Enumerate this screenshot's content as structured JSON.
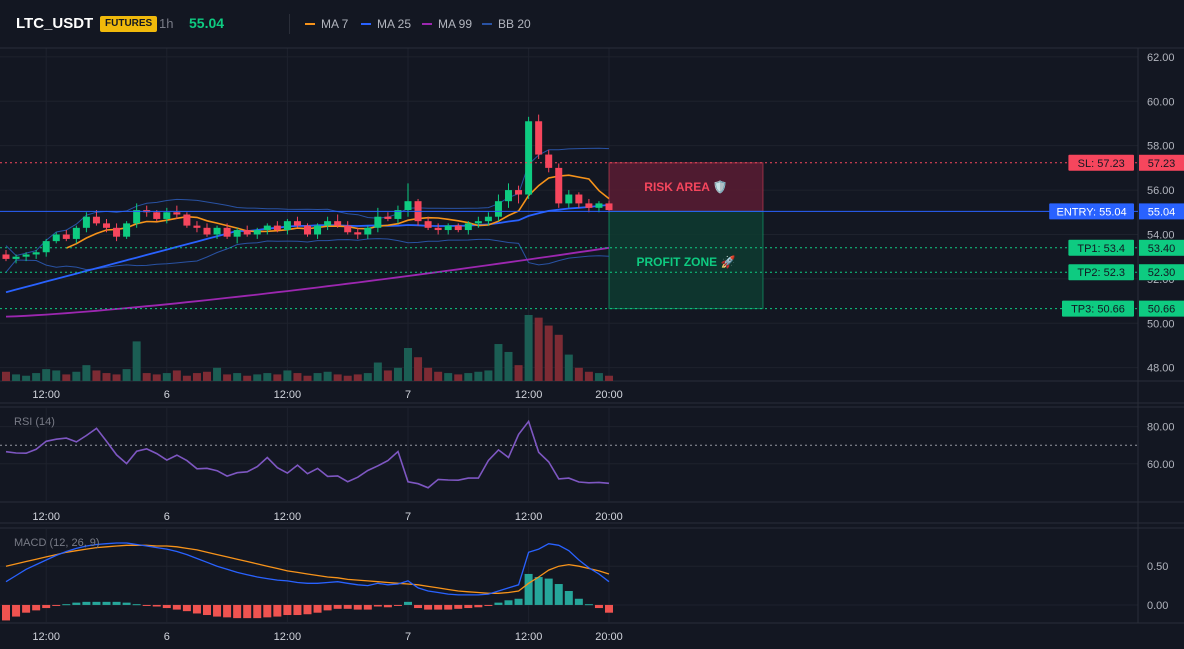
{
  "header": {
    "symbol": "LTC_USDT",
    "badge": "FUTURES",
    "timeframe": "1h",
    "price": "55.04",
    "legend": [
      {
        "label": "MA 7",
        "color": "#f7931a"
      },
      {
        "label": "MA 25",
        "color": "#2962ff"
      },
      {
        "label": "MA 99",
        "color": "#9c27b0"
      },
      {
        "label": "BB 20",
        "color": "#2952a3"
      }
    ]
  },
  "colors": {
    "bg": "#131722",
    "grid": "#1e222d",
    "text": "#b2b5be",
    "up": "#0ecb81",
    "down": "#f6465d",
    "volUp": "#1b5e54",
    "volDown": "#7d2b34",
    "ma7": "#f7931a",
    "ma25": "#2962ff",
    "ma99": "#9c27b0",
    "bb": "#2952a3",
    "rsi": "#7e57c2",
    "macd": "#2962ff",
    "signal": "#f7931a",
    "histUp": "#26a69a",
    "histDown": "#ef5350"
  },
  "chart_data": [
    {
      "type": "candlestick",
      "x_tick_labels": [
        "12:00",
        "6",
        "12:00",
        "7",
        "12:00",
        "20:00"
      ],
      "x_tick_index": [
        4,
        16,
        28,
        40,
        52,
        60
      ],
      "y_tick_labels": [
        "48.00",
        "50.00",
        "52.00",
        "54.00",
        "56.00",
        "58.00",
        "60.00",
        "62.00"
      ],
      "ylim": [
        47.4,
        62.4
      ],
      "candles": [
        [
          53.1,
          53.3,
          52.8,
          52.9
        ],
        [
          52.9,
          53.1,
          52.7,
          53.0
        ],
        [
          53.0,
          53.2,
          52.8,
          53.1
        ],
        [
          53.1,
          53.3,
          52.9,
          53.2
        ],
        [
          53.2,
          53.8,
          53.0,
          53.7
        ],
        [
          53.7,
          54.1,
          53.6,
          54.0
        ],
        [
          54.0,
          54.2,
          53.7,
          53.8
        ],
        [
          53.8,
          54.4,
          53.6,
          54.3
        ],
        [
          54.3,
          55.0,
          54.1,
          54.8
        ],
        [
          54.8,
          55.1,
          54.4,
          54.5
        ],
        [
          54.5,
          54.7,
          54.1,
          54.3
        ],
        [
          54.3,
          54.5,
          53.7,
          53.9
        ],
        [
          53.9,
          54.6,
          53.8,
          54.5
        ],
        [
          54.5,
          55.4,
          54.3,
          55.1
        ],
        [
          55.1,
          55.3,
          54.8,
          55.0
        ],
        [
          55.0,
          55.1,
          54.6,
          54.7
        ],
        [
          54.7,
          55.2,
          54.5,
          55.0
        ],
        [
          55.0,
          55.3,
          54.7,
          54.9
        ],
        [
          54.9,
          55.0,
          54.3,
          54.4
        ],
        [
          54.4,
          54.6,
          54.1,
          54.3
        ],
        [
          54.3,
          54.5,
          53.9,
          54.0
        ],
        [
          54.0,
          54.4,
          53.8,
          54.3
        ],
        [
          54.3,
          54.5,
          53.8,
          53.9
        ],
        [
          53.9,
          54.3,
          53.6,
          54.2
        ],
        [
          54.2,
          54.4,
          53.9,
          54.0
        ],
        [
          54.0,
          54.3,
          53.8,
          54.2
        ],
        [
          54.2,
          54.5,
          54.0,
          54.4
        ],
        [
          54.4,
          54.6,
          54.1,
          54.2
        ],
        [
          54.2,
          54.7,
          54.0,
          54.6
        ],
        [
          54.6,
          54.8,
          54.3,
          54.4
        ],
        [
          54.4,
          54.5,
          53.9,
          54.0
        ],
        [
          54.0,
          54.5,
          53.8,
          54.4
        ],
        [
          54.4,
          54.8,
          54.2,
          54.6
        ],
        [
          54.6,
          54.9,
          54.3,
          54.4
        ],
        [
          54.4,
          54.6,
          54.0,
          54.1
        ],
        [
          54.1,
          54.3,
          53.8,
          54.0
        ],
        [
          54.0,
          54.4,
          53.8,
          54.3
        ],
        [
          54.3,
          55.2,
          54.1,
          54.8
        ],
        [
          54.8,
          55.0,
          54.6,
          54.7
        ],
        [
          54.7,
          55.3,
          54.5,
          55.1
        ],
        [
          55.1,
          56.3,
          54.8,
          55.5
        ],
        [
          55.5,
          55.6,
          54.4,
          54.6
        ],
        [
          54.6,
          54.8,
          54.2,
          54.3
        ],
        [
          54.3,
          54.5,
          54.0,
          54.2
        ],
        [
          54.2,
          54.5,
          54.0,
          54.4
        ],
        [
          54.4,
          54.5,
          54.1,
          54.2
        ],
        [
          54.2,
          54.6,
          54.0,
          54.5
        ],
        [
          54.5,
          54.8,
          54.3,
          54.6
        ],
        [
          54.6,
          55.0,
          54.4,
          54.8
        ],
        [
          54.8,
          55.8,
          54.6,
          55.5
        ],
        [
          55.5,
          56.3,
          55.2,
          56.0
        ],
        [
          56.0,
          56.2,
          55.4,
          55.8
        ],
        [
          55.8,
          59.3,
          55.6,
          59.1
        ],
        [
          59.1,
          59.4,
          57.4,
          57.6
        ],
        [
          57.6,
          57.8,
          56.8,
          57.0
        ],
        [
          57.0,
          57.2,
          55.2,
          55.4
        ],
        [
          55.4,
          56.0,
          55.2,
          55.8
        ],
        [
          55.8,
          55.9,
          55.2,
          55.4
        ],
        [
          55.4,
          55.6,
          55.0,
          55.2
        ],
        [
          55.2,
          55.5,
          55.0,
          55.4
        ],
        [
          55.4,
          55.5,
          55.0,
          55.1
        ]
      ],
      "volume": [
        7,
        5,
        4,
        6,
        9,
        8,
        5,
        7,
        12,
        8,
        6,
        5,
        9,
        30,
        6,
        5,
        6,
        8,
        4,
        6,
        7,
        10,
        5,
        6,
        4,
        5,
        6,
        5,
        8,
        6,
        4,
        6,
        7,
        5,
        4,
        5,
        6,
        14,
        8,
        10,
        25,
        18,
        10,
        7,
        6,
        5,
        6,
        7,
        8,
        28,
        22,
        12,
        50,
        48,
        42,
        35,
        20,
        10,
        7,
        6,
        4
      ]
    },
    {
      "type": "line",
      "name": "RSI (14)",
      "ylim": [
        40,
        90
      ],
      "y_tick_labels": [
        "60.00",
        "80.00"
      ],
      "values": [
        66.5,
        65.8,
        65.7,
        67.8,
        72.1,
        73.2,
        73.8,
        71.8,
        75.2,
        79.1,
        72.1,
        64.8,
        60.1,
        66.8,
        68.0,
        65.5,
        62.0,
        64.7,
        61.7,
        57.3,
        57.6,
        56.3,
        53.4,
        55.2,
        55.7,
        58.5,
        63.4,
        57.9,
        55.0,
        59.3,
        54.7,
        57.5,
        53.2,
        53.5,
        50.4,
        52.8,
        56.4,
        58.9,
        61.7,
        66.6,
        50.3,
        49.3,
        47.1,
        51.6,
        51.3,
        51.2,
        52.3,
        52.3,
        61.8,
        67.5,
        63.4,
        75.8,
        82.8,
        66.2,
        61.0,
        51.9,
        52.3,
        50.2,
        49.8,
        50.0,
        49.5
      ]
    },
    {
      "type": "line",
      "name": "MACD (12, 26, 9)",
      "ylim": [
        -0.22,
        0.98
      ],
      "y_tick_labels": [
        "0.00",
        "0.50"
      ],
      "macd": [
        0.3,
        0.38,
        0.46,
        0.52,
        0.58,
        0.64,
        0.69,
        0.73,
        0.76,
        0.78,
        0.79,
        0.8,
        0.8,
        0.78,
        0.76,
        0.74,
        0.72,
        0.69,
        0.65,
        0.6,
        0.55,
        0.5,
        0.46,
        0.42,
        0.39,
        0.36,
        0.34,
        0.32,
        0.31,
        0.29,
        0.28,
        0.28,
        0.29,
        0.3,
        0.28,
        0.26,
        0.25,
        0.28,
        0.26,
        0.27,
        0.31,
        0.22,
        0.18,
        0.16,
        0.14,
        0.13,
        0.13,
        0.13,
        0.14,
        0.18,
        0.22,
        0.26,
        0.68,
        0.72,
        0.79,
        0.77,
        0.7,
        0.58,
        0.48,
        0.4,
        0.3
      ],
      "signal": [
        0.5,
        0.53,
        0.56,
        0.59,
        0.62,
        0.65,
        0.68,
        0.7,
        0.72,
        0.74,
        0.75,
        0.76,
        0.77,
        0.77,
        0.77,
        0.76,
        0.76,
        0.75,
        0.73,
        0.71,
        0.68,
        0.65,
        0.62,
        0.59,
        0.56,
        0.53,
        0.5,
        0.47,
        0.44,
        0.42,
        0.4,
        0.38,
        0.36,
        0.35,
        0.33,
        0.32,
        0.31,
        0.3,
        0.29,
        0.28,
        0.27,
        0.26,
        0.24,
        0.22,
        0.2,
        0.18,
        0.17,
        0.16,
        0.15,
        0.15,
        0.16,
        0.18,
        0.28,
        0.36,
        0.45,
        0.5,
        0.52,
        0.5,
        0.47,
        0.44,
        0.4
      ]
    }
  ],
  "levels": {
    "sl": {
      "label": "SL: 57.23",
      "price": "57.23",
      "value": 57.23
    },
    "entry": {
      "label": "ENTRY: 55.04",
      "price": "55.04",
      "value": 55.04
    },
    "tp": [
      {
        "label": "TP1: 53.4",
        "price": "53.40",
        "value": 53.4
      },
      {
        "label": "TP2: 52.3",
        "price": "52.30",
        "value": 52.3
      },
      {
        "label": "TP3: 50.66",
        "price": "50.66",
        "value": 50.66
      }
    ],
    "risk_area": "RISK AREA 🛡️",
    "profit_zone": "PROFIT ZONE 🚀"
  }
}
